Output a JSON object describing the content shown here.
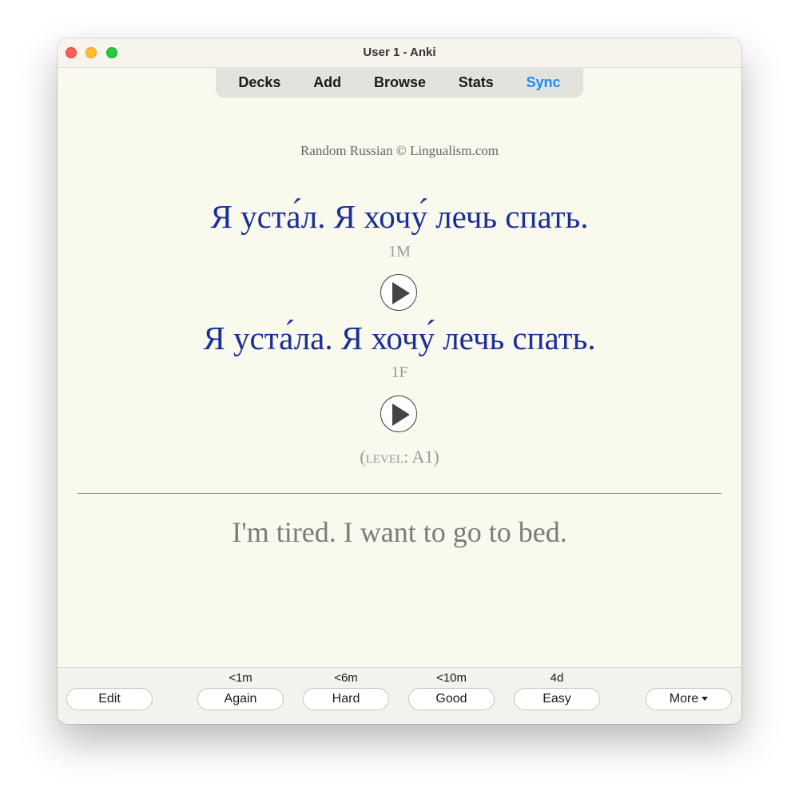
{
  "window": {
    "title": "User 1 - Anki"
  },
  "toolbar": {
    "decks": "Decks",
    "add": "Add",
    "browse": "Browse",
    "stats": "Stats",
    "sync": "Sync"
  },
  "card": {
    "credit": "Random Russian © Lingualism.com",
    "male_sentence": "Я уста́л. Я хочу́ лечь спать.",
    "male_label": "1M",
    "female_sentence": "Я уста́ла. Я хочу́ лечь спать.",
    "female_label": "1F",
    "level_open": "(",
    "level_word": "level",
    "level_sep": ": ",
    "level_value": "A1",
    "level_close": ")",
    "translation": "I'm tired. I want to go to bed."
  },
  "bottom": {
    "edit": "Edit",
    "again_interval": "<1m",
    "again": "Again",
    "hard_interval": "<6m",
    "hard": "Hard",
    "good_interval": "<10m",
    "good": "Good",
    "easy_interval": "4d",
    "easy": "Easy",
    "more": "More"
  },
  "icons": {
    "play": "play-icon",
    "more_caret": "chevron-down-icon"
  },
  "colors": {
    "accent": "#1a8cff",
    "russian_text": "#1a2e99",
    "card_background": "#f9f9ee"
  }
}
